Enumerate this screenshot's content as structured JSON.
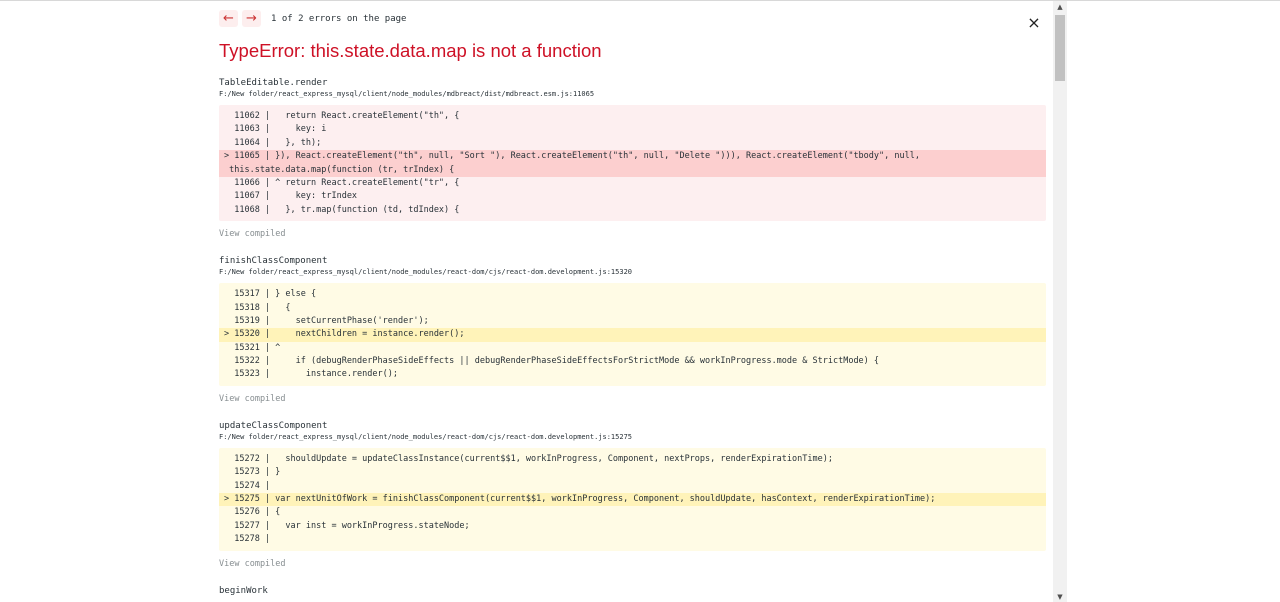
{
  "nav": {
    "prev_icon": "←",
    "next_icon": "→",
    "counter_text": "1 of 2 errors on the page",
    "close_icon": "×"
  },
  "error": {
    "title": "TypeError: this.state.data.map is not a function"
  },
  "frames": [
    {
      "function": "TableEditable.render",
      "path": "F:/New folder/react_express_mysql/client/node_modules/mdbreact/dist/mdbreact.esm.js:11065",
      "style": "red",
      "lines": [
        "  11062 |   return React.createElement(\"th\", {",
        "  11063 |     key: i",
        "  11064 |   }, th);",
        "> 11065 | }), React.createElement(\"th\", null, \"Sort \"), React.createElement(\"th\", null, \"Delete \"))), React.createElement(\"tbody\", null,",
        " this.state.data.map(function (tr, trIndex) {",
        "  11066 | ^ return React.createElement(\"tr\", {",
        "  11067 |     key: trIndex",
        "  11068 |   }, tr.map(function (td, tdIndex) {"
      ],
      "highlight": [
        3,
        4
      ],
      "view_compiled": "View compiled"
    },
    {
      "function": "finishClassComponent",
      "path": "F:/New folder/react_express_mysql/client/node_modules/react-dom/cjs/react-dom.development.js:15320",
      "style": "yellow",
      "lines": [
        "  15317 | } else {",
        "  15318 |   {",
        "  15319 |     setCurrentPhase('render');",
        "> 15320 |     nextChildren = instance.render();",
        "  15321 | ^",
        "  15322 |     if (debugRenderPhaseSideEffects || debugRenderPhaseSideEffectsForStrictMode && workInProgress.mode & StrictMode) {",
        "  15323 |       instance.render();"
      ],
      "highlight": [
        3
      ],
      "view_compiled": "View compiled"
    },
    {
      "function": "updateClassComponent",
      "path": "F:/New folder/react_express_mysql/client/node_modules/react-dom/cjs/react-dom.development.js:15275",
      "style": "yellow",
      "lines": [
        "  15272 |   shouldUpdate = updateClassInstance(current$$1, workInProgress, Component, nextProps, renderExpirationTime);",
        "  15273 | }",
        "  15274 |",
        "> 15275 | var nextUnitOfWork = finishClassComponent(current$$1, workInProgress, Component, shouldUpdate, hasContext, renderExpirationTime);",
        "  15276 | {",
        "  15277 |   var inst = workInProgress.stateNode;",
        "  15278 |"
      ],
      "highlight": [
        3
      ],
      "view_compiled": "View compiled"
    },
    {
      "function": "beginWork",
      "path": "",
      "style": "none",
      "lines": [],
      "highlight": [],
      "view_compiled": ""
    }
  ],
  "colors": {
    "error_red": "#ce1126",
    "code_red_bg": "#fdeff0",
    "code_red_highlight": "#fccfcf",
    "code_yellow_bg": "#fffbe5",
    "code_yellow_highlight": "#fff3b9"
  },
  "scrollbar": {
    "up_icon": "▲",
    "down_icon": "▼"
  }
}
